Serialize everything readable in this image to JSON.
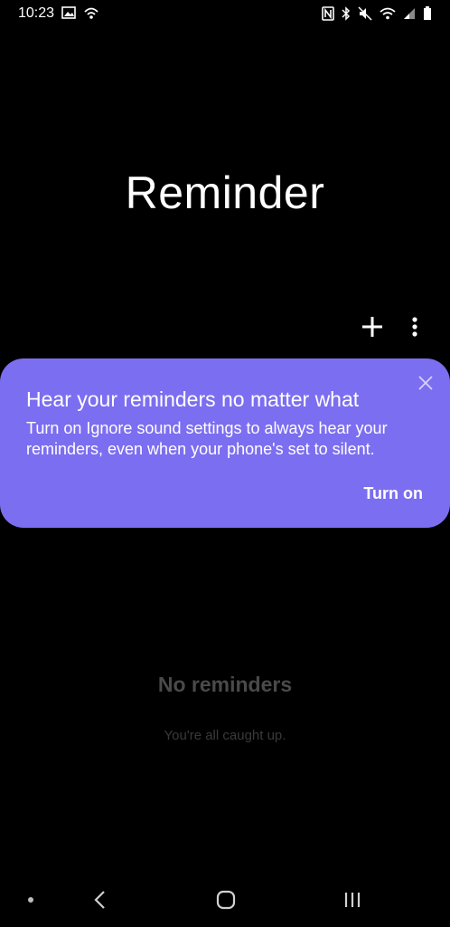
{
  "status_bar": {
    "time": "10:23",
    "left_icons": [
      "image-icon",
      "wifi-call-icon"
    ],
    "right_icons": [
      "nfc-icon",
      "bluetooth-icon",
      "mute-icon",
      "wifi-icon",
      "signal-icon",
      "battery-icon"
    ]
  },
  "page": {
    "title": "Reminder"
  },
  "toolbar": {
    "add_icon": "plus-icon",
    "more_icon": "more-vertical-icon"
  },
  "banner": {
    "title": "Hear your reminders no matter what",
    "body": "Turn on Ignore sound settings to always hear your reminders, even when your phone's set to silent.",
    "action_label": "Turn on",
    "close_icon": "close-icon",
    "background": "#7c6ef0"
  },
  "empty_state": {
    "title": "No reminders",
    "subtitle": "You're all caught up."
  },
  "nav_bar": {
    "icons": [
      "dot-icon",
      "back-icon",
      "home-icon",
      "recents-icon"
    ]
  },
  "colors": {
    "background": "#000000",
    "accent": "#7c6ef0",
    "muted_text": "#4a4a4a"
  }
}
